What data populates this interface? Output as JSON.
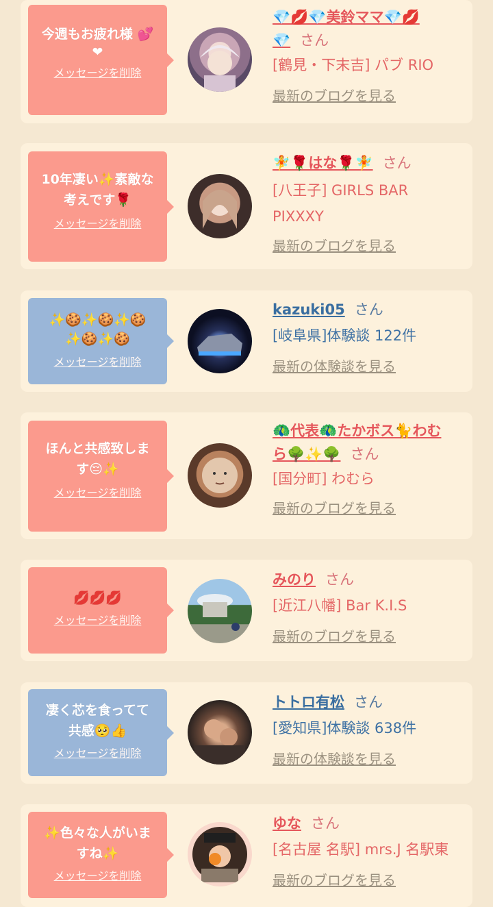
{
  "delete_label": "メッセージを削除",
  "cards": [
    {
      "bubble_color": "#fb9a8d",
      "message": [
        "今週もお疲れ様 💕",
        "❤"
      ],
      "name": "💎💋💎美鈴ママ💎💋",
      "name_line2": "💎",
      "san": "さん",
      "detail1": "[鶴見・下末吉] パブ RIO",
      "link": "最新のブログを見る"
    },
    {
      "bubble_color": "#fb9a8d",
      "message": [
        "10年凄い✨素敵な",
        "考えです🌹"
      ],
      "name": "🧚🌹はな🌹🧚",
      "san": "さん",
      "detail1": "[八王子] GIRLS BAR",
      "detail2": "PIXXXY",
      "link": "最新のブログを見る"
    },
    {
      "bubble_color": "#9ab6d8",
      "message": [
        "✨🍪✨🍪✨🍪",
        "✨🍪✨🍪"
      ],
      "name": "kazuki05",
      "san": "さん",
      "detail1": "[岐阜県]体験談 122件",
      "link": "最新の体験談を見る"
    },
    {
      "bubble_color": "#fb9a8d",
      "message": [
        "ほんと共感致しま",
        "す😔✨"
      ],
      "name": "🦚代表🦚たかボス🐈わむ",
      "name_line2": "ら🌳✨🌳",
      "san": "さん",
      "detail1": "[国分町] わむら",
      "link": "最新のブログを見る"
    },
    {
      "bubble_color": "#fb9a8d",
      "message": [
        "💋💋💋"
      ],
      "name": "みのり",
      "san": "さん",
      "detail1": "[近江八幡] Bar K.I.S",
      "link": "最新のブログを見る"
    },
    {
      "bubble_color": "#9ab6d8",
      "message": [
        "凄く芯を食ってて",
        "共感🥺👍"
      ],
      "name": "トトロ有松",
      "san": "さん",
      "detail1": "[愛知県]体験談 638件",
      "link": "最新の体験談を見る"
    },
    {
      "bubble_color": "#fb9a8d",
      "message": [
        "✨色々な人がいま",
        "すね✨"
      ],
      "name": "ゆな",
      "san": "さん",
      "detail1": "[名古屋 名駅] mrs.J 名駅東",
      "link": "最新のブログを見る"
    }
  ]
}
